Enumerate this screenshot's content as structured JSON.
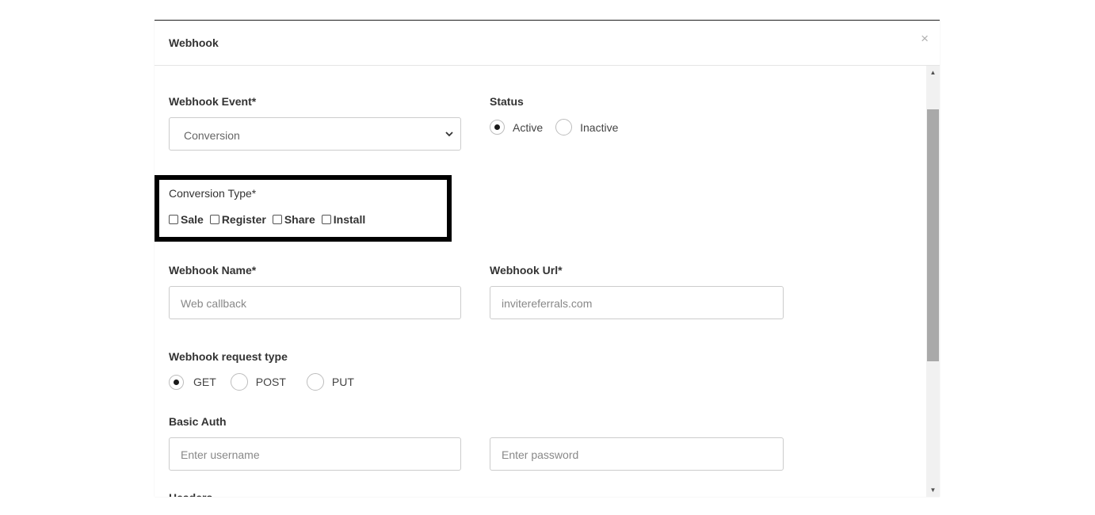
{
  "modal": {
    "title": "Webhook",
    "close_symbol": "×"
  },
  "webhook_event": {
    "label": "Webhook Event*",
    "selected": "Conversion"
  },
  "status": {
    "label": "Status",
    "options": [
      {
        "label": "Active",
        "checked": true
      },
      {
        "label": "Inactive",
        "checked": false
      }
    ]
  },
  "conversion_type": {
    "label": "Conversion Type*",
    "options": [
      {
        "label": "Sale",
        "checked": false
      },
      {
        "label": "Register",
        "checked": false
      },
      {
        "label": "Share",
        "checked": false
      },
      {
        "label": "Install",
        "checked": false
      }
    ]
  },
  "webhook_name": {
    "label": "Webhook Name*",
    "placeholder": "Web callback"
  },
  "webhook_url": {
    "label": "Webhook Url*",
    "placeholder": "invitereferrals.com"
  },
  "request_type": {
    "label": "Webhook request type",
    "options": [
      {
        "label": "GET",
        "checked": true
      },
      {
        "label": "POST",
        "checked": false
      },
      {
        "label": "PUT",
        "checked": false
      }
    ]
  },
  "basic_auth": {
    "label": "Basic Auth",
    "username_placeholder": "Enter username",
    "password_placeholder": "Enter password"
  },
  "next_section_label": "Headers",
  "icons": {
    "close": "close-icon",
    "select": "chevron-down-icon",
    "scroll_up": "triangle-up-icon",
    "scroll_down": "triangle-down-icon"
  },
  "colors": {
    "highlight_border": "#000000",
    "radio_checked": "#1a1a1a",
    "scroll_thumb": "#a9a9a9"
  }
}
